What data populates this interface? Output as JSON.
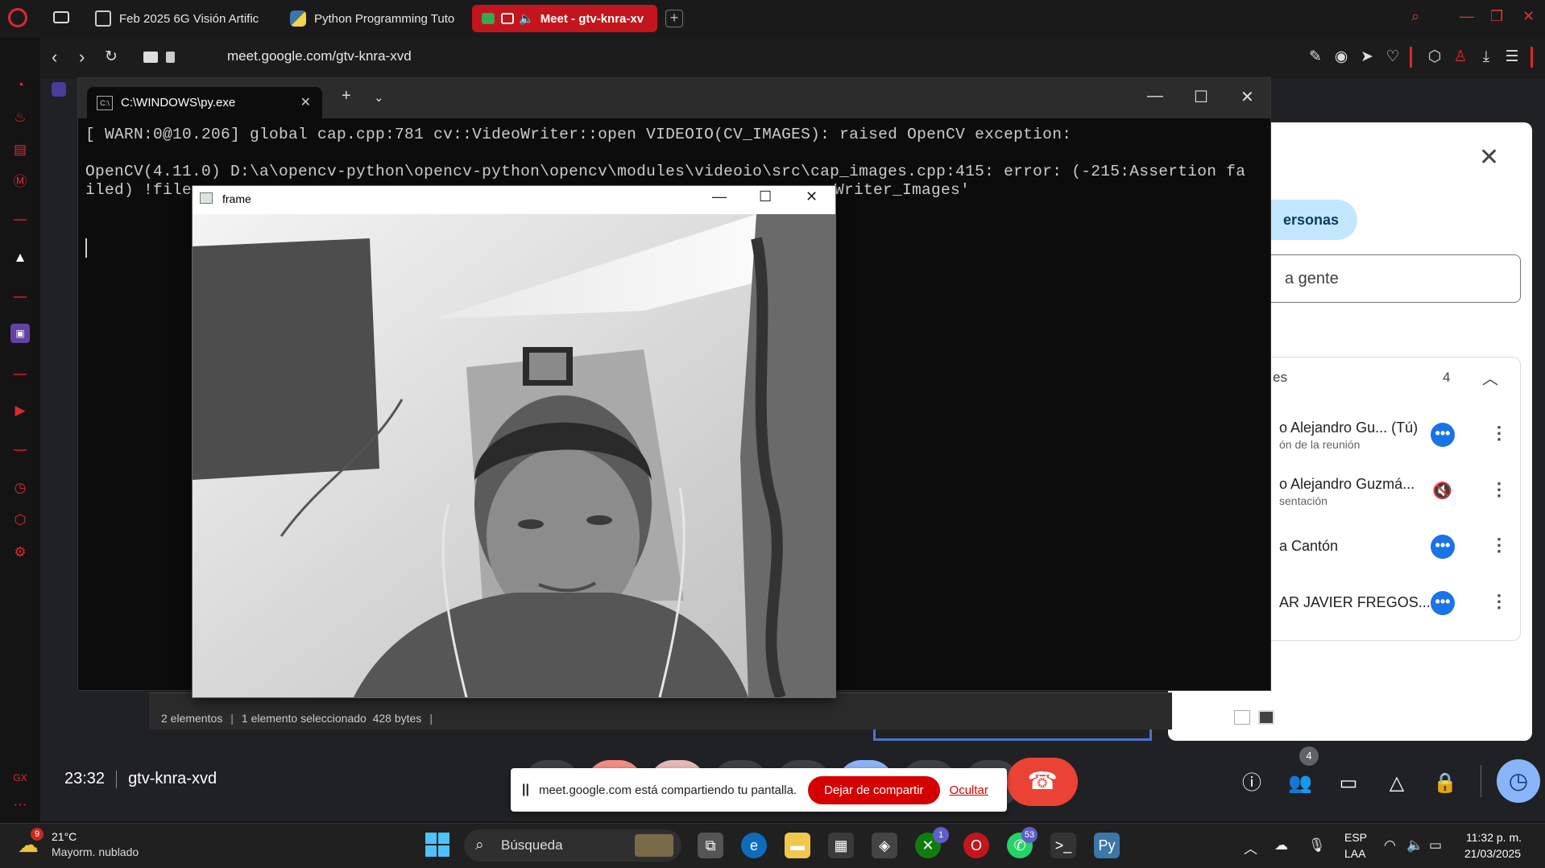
{
  "browser": {
    "tabs": [
      {
        "label": "Feb 2025 6G Visión Artific"
      },
      {
        "label": "Python Programming Tuto"
      },
      {
        "label": "Meet - gtv-knra-xv"
      }
    ],
    "url": "meet.google.com/gtv-knra-xvd"
  },
  "terminal": {
    "tab_title": "C:\\WINDOWS\\py.exe",
    "icon_text": "C:\\",
    "lines": [
      "[ WARN:0@10.206] global cap.cpp:781 cv::VideoWriter::open VIDEOIO(CV_IMAGES): raised OpenCV exception:",
      "OpenCV(4.11.0) D:\\a\\opencv-python\\opencv-python\\opencv\\modules\\videoio\\src\\cap_images.cpp:415: error: (-215:Assertion fa",
      "iled) !file",
      "Writer_Images'"
    ]
  },
  "cv_window": {
    "title": "frame"
  },
  "explorer": {
    "items": "2 elementos",
    "selected": "1 elemento seleccionado",
    "size": "428 bytes"
  },
  "meet": {
    "time": "23:32",
    "code": "gtv-knra-xvd",
    "share_banner": {
      "text": "meet.google.com está compartiendo tu pantalla.",
      "stop_label": "Dejar de compartir",
      "hide_label": "Ocultar"
    },
    "people_badge": "4",
    "people_panel": {
      "tab_label": "ersonas",
      "search_placeholder": "a gente",
      "section_title": "es",
      "section_count": "4",
      "participants": [
        {
          "name": "o Alejandro Gu...   (Tú)",
          "sub": "ón de la reunión"
        },
        {
          "name": "o Alejandro Guzmá...",
          "sub": "sentación"
        },
        {
          "name": "a Cantón",
          "sub": ""
        },
        {
          "name": "AR JAVIER FREGOS...",
          "sub": ""
        }
      ]
    }
  },
  "taskbar": {
    "weather_badge": "9",
    "temperature": "21°C",
    "weather_desc": "Mayorm. nublado",
    "search_label": "Búsqueda",
    "xbox_badge": "1",
    "whatsapp_badge": "53",
    "lang_top": "ESP",
    "lang_bottom": "LAA",
    "time": "11:32 p. m.",
    "date": "21/03/2025"
  },
  "colors": {
    "opera_red": "#c4151c",
    "meet_bg": "#202124",
    "end_call": "#ea4335",
    "stop_share": "#d50000"
  }
}
